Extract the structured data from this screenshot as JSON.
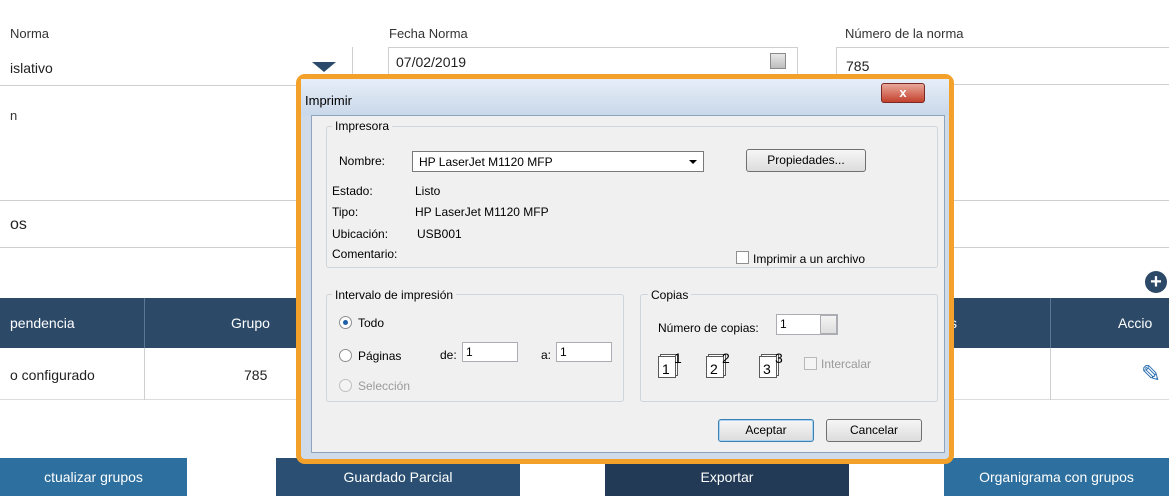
{
  "form": {
    "tipo_norma_label": "Norma",
    "tipo_norma_value": "islativo",
    "fecha_label": "Fecha Norma",
    "fecha_value": "07/02/2019",
    "numero_label": "Número de la norma",
    "numero_value": "785",
    "descripcion_label": "n",
    "section_title": "os"
  },
  "table": {
    "headers": [
      "pendencia",
      "Grupo",
      "s",
      "Accio"
    ],
    "row": {
      "dependencia": "o configurado",
      "grupo": "785"
    }
  },
  "bottom_buttons": [
    {
      "label": "ctualizar grupos"
    },
    {
      "label": "Guardado Parcial"
    },
    {
      "label": "Exportar"
    },
    {
      "label": "Organigrama con grupos"
    }
  ],
  "dialog": {
    "title": "Imprimir",
    "close_label": "x",
    "impresora": {
      "group_title": "Impresora",
      "nombre_label": "Nombre:",
      "nombre_value": "HP LaserJet M1120 MFP",
      "propiedades_label": "Propiedades...",
      "estado_label": "Estado:",
      "estado_value": "Listo",
      "tipo_label": "Tipo:",
      "tipo_value": "HP LaserJet M1120 MFP",
      "ubicacion_label": "Ubicación:",
      "ubicacion_value": "USB001",
      "comentario_label": "Comentario:",
      "imprimir_archivo_label": "Imprimir a un archivo"
    },
    "intervalo": {
      "group_title": "Intervalo de impresión",
      "todo_label": "Todo",
      "paginas_label": "Páginas",
      "de_label": "de:",
      "de_value": "1",
      "a_label": "a:",
      "a_value": "1",
      "seleccion_label": "Selección"
    },
    "copias": {
      "group_title": "Copias",
      "numero_label": "Número de copias:",
      "numero_value": "1",
      "pages": [
        "1",
        "1",
        "2",
        "2",
        "3",
        "3"
      ],
      "intercalar_label": "Intercalar"
    },
    "aceptar_label": "Aceptar",
    "cancelar_label": "Cancelar"
  },
  "colors": {
    "header_bg": "#2c4a68",
    "button_bg": "#2a4f72",
    "dialog_highlight": "#f3a12a",
    "accent_blue": "#2b6fb2"
  }
}
